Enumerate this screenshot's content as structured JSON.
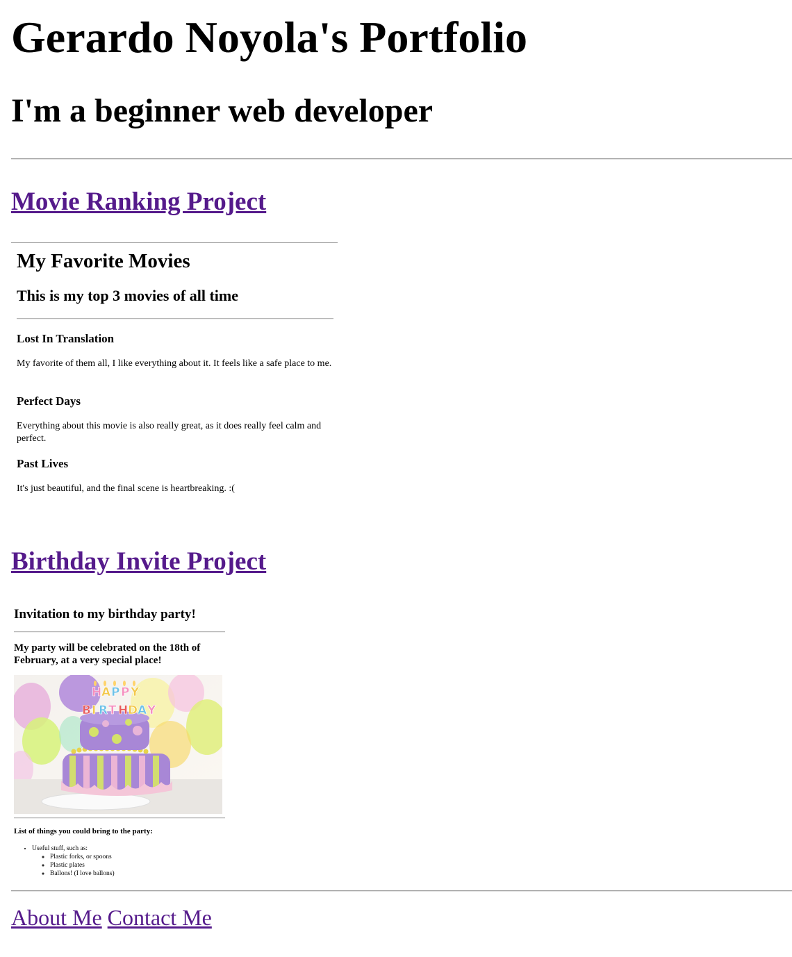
{
  "header": {
    "title": "Gerardo Noyola's Portfolio",
    "subtitle": "I'm a beginner web developer"
  },
  "projects": [
    {
      "link_label": "Movie Ranking Project",
      "preview": {
        "heading": "My Favorite Movies",
        "subheading": "This is my top 3 movies of all time",
        "movies": [
          {
            "title": "Lost In Translation",
            "description": "My favorite of them all, I like everything about it. It feels like a safe place to me."
          },
          {
            "title": "Perfect Days",
            "description": "Everything about this movie is also really great, as it does really feel calm and perfect."
          },
          {
            "title": "Past Lives",
            "description": "It's just beautiful, and the final scene is heartbreaking. :("
          }
        ]
      }
    },
    {
      "link_label": "Birthday Invite Project",
      "preview": {
        "heading": "Invitation to my birthday party!",
        "details": "My party will be celebrated on the 18th of February, at a very special place!",
        "list_heading": "List of things you could bring to the party:",
        "list": {
          "item": "Useful stuff, such as:",
          "subitems": [
            "Plastic forks, or spoons",
            "Plastic plates",
            "Ballons! (I love ballons)"
          ]
        }
      }
    }
  ],
  "footer": {
    "about_label": "About Me",
    "contact_label": "Contact Me"
  },
  "colors": {
    "visited_link": "#551a8b",
    "rule": "#9a9a9a"
  }
}
